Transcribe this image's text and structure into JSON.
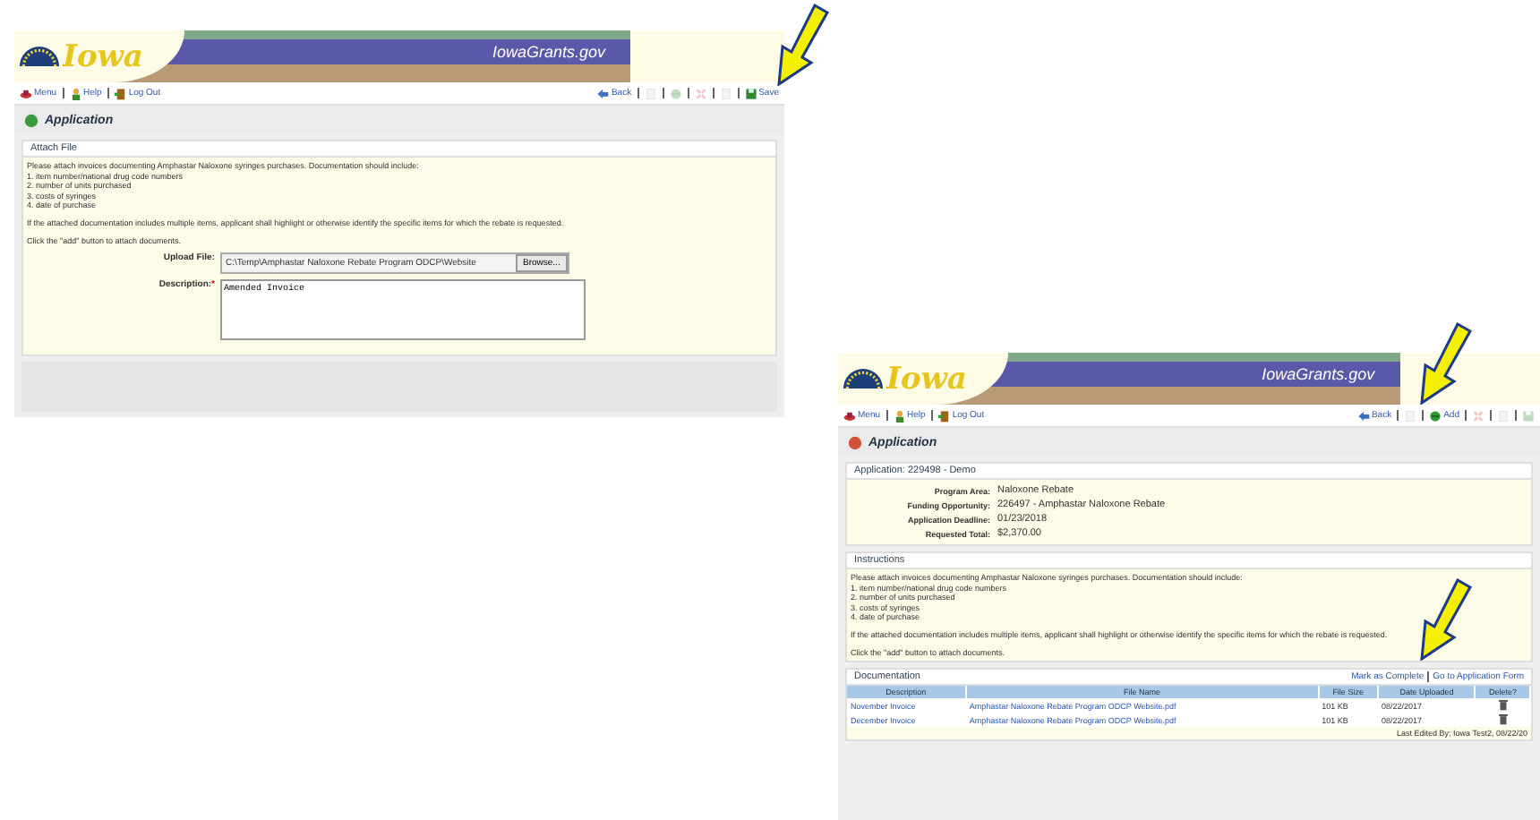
{
  "attach_file_screen": {
    "site_title": "IowaGrants.gov",
    "logo_text": "Iowa",
    "nav": [
      {
        "kind": "menu",
        "label": "Menu"
      },
      {
        "kind": "help",
        "label": "Help"
      },
      {
        "kind": "logout",
        "label": "Log Out"
      }
    ],
    "toolbar": [
      {
        "kind": "back",
        "label": "Back",
        "disabled": false
      },
      {
        "kind": "page",
        "disabled": true
      },
      {
        "kind": "green",
        "disabled": true
      },
      {
        "kind": "cross",
        "disabled": true
      },
      {
        "kind": "page",
        "disabled": true
      },
      {
        "kind": "save",
        "label": "Save",
        "disabled": false
      }
    ],
    "page_title": "Application",
    "panel_title": "Attach File",
    "instructions": [
      "Please attach invoices documenting Amphastar Naloxone syringes purchases. Documentation should include:",
      "1. item number/national drug code numbers",
      "2. number of units purchased",
      "3. costs of syringes",
      "4. date of purchase"
    ],
    "notes": [
      "If the attached documentation includes multiple items, applicant shall highlight or otherwise identify the specific items for which the rebate is requested.",
      "Click the \"add\" button to attach documents."
    ],
    "fields": [
      {
        "kind": "file",
        "label": "Upload File:",
        "value": "C:\\Temp\\Amphastar Naloxone Rebate Program ODCP\\Website",
        "button": "Browse..."
      },
      {
        "kind": "textarea",
        "label": "Description:",
        "required_mark": "*",
        "value": "Amended Invoice"
      }
    ]
  },
  "application_screen": {
    "site_title": "IowaGrants.gov",
    "logo_text": "Iowa",
    "nav": [
      {
        "kind": "menu",
        "label": "Menu"
      },
      {
        "kind": "help",
        "label": "Help"
      },
      {
        "kind": "logout",
        "label": "Log Out"
      }
    ],
    "toolbar": [
      {
        "kind": "back",
        "label": "Back",
        "disabled": false
      },
      {
        "kind": "page",
        "disabled": true
      },
      {
        "kind": "add",
        "label": "Add",
        "disabled": false
      },
      {
        "kind": "cross",
        "disabled": true
      },
      {
        "kind": "page",
        "disabled": true
      },
      {
        "kind": "save",
        "disabled": true
      }
    ],
    "page_title": "Application",
    "summary_title": "Application: 229498 - Demo",
    "summary": [
      {
        "label": "Program Area:",
        "value": "Naloxone Rebate"
      },
      {
        "label": "Funding Opportunity:",
        "value": "226497 - Amphastar Naloxone Rebate"
      },
      {
        "label": "Application Deadline:",
        "value": "01/23/2018"
      },
      {
        "label": "Requested Total:",
        "value": "$2,370.00"
      }
    ],
    "instructions_title": "Instructions",
    "instructions": [
      "Please attach invoices documenting Amphastar Naloxone syringes purchases. Documentation should include:",
      "1. item number/national drug code numbers",
      "2. number of units purchased",
      "3. costs of syringes",
      "4. date of purchase"
    ],
    "notes": [
      "If the attached documentation includes multiple items, applicant shall highlight or otherwise identify the specific items for which the rebate is requested.",
      "Click the \"add\" button to attach documents."
    ],
    "documentation": {
      "title": "Documentation",
      "links": [
        "Mark as Complete",
        "Go to Application Form"
      ],
      "columns": [
        "Description",
        "File Name",
        "File Size",
        "Date Uploaded",
        "Delete?"
      ],
      "rows": [
        {
          "description": "November Invoice",
          "file_name": "Amphastar Naloxone Rebate Program ODCP Website.pdf",
          "file_size": "101 KB",
          "date_uploaded": "08/22/2017"
        },
        {
          "description": "December Invoice",
          "file_name": "Amphastar Naloxone Rebate Program ODCP Website.pdf",
          "file_size": "101 KB",
          "date_uploaded": "08/22/2017"
        }
      ],
      "last_edited": "Last Edited By: Iowa Test2, 08/22/20"
    }
  }
}
